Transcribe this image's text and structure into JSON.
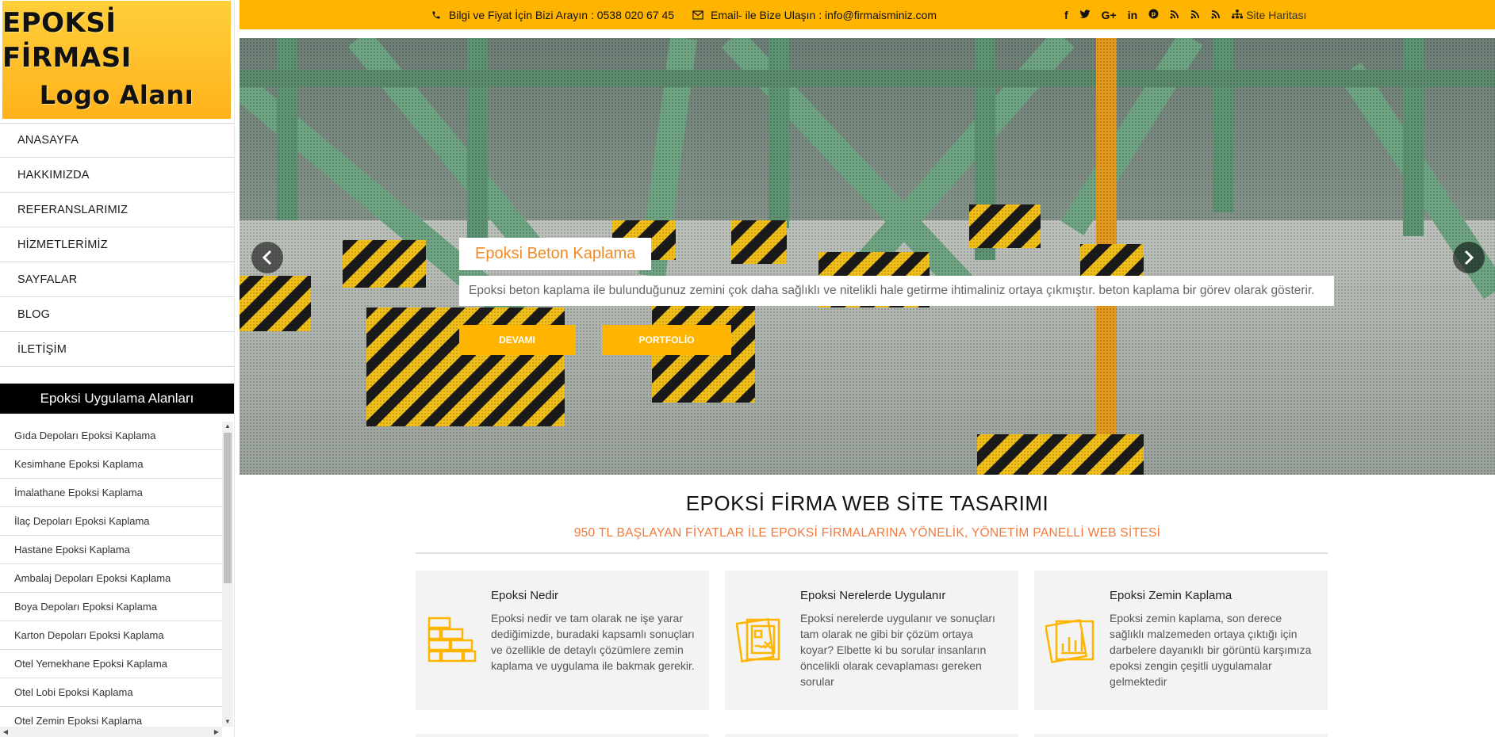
{
  "sidebar": {
    "logo_line1": "EPOKSİ FİRMASI",
    "logo_line2": "Logo Alanı",
    "nav": [
      {
        "label": "ANASAYFA"
      },
      {
        "label": "HAKKIMIZDA"
      },
      {
        "label": "REFERANSLARIMIZ"
      },
      {
        "label": "HİZMETLERİMİZ"
      },
      {
        "label": "SAYFALAR"
      },
      {
        "label": "BLOG"
      },
      {
        "label": "İLETİŞİM"
      }
    ],
    "apps_header": "Epoksi Uygulama Alanları",
    "apps": [
      {
        "label": "Gıda Depoları Epoksi Kaplama"
      },
      {
        "label": "Kesimhane Epoksi Kaplama"
      },
      {
        "label": "İmalathane Epoksi Kaplama"
      },
      {
        "label": "İlaç Depoları Epoksi Kaplama"
      },
      {
        "label": "Hastane Epoksi Kaplama"
      },
      {
        "label": "Ambalaj Depoları Epoksi Kaplama"
      },
      {
        "label": "Boya Depoları Epoksi Kaplama"
      },
      {
        "label": "Karton Depoları Epoksi Kaplama"
      },
      {
        "label": "Otel Yemekhane Epoksi Kaplama"
      },
      {
        "label": "Otel Lobi Epoksi Kaplama"
      },
      {
        "label": "Otel Zemin Epoksi Kaplama"
      }
    ]
  },
  "topbar": {
    "phone_text": "Bilgi ve Fiyat İçin Bizi Arayın : 0538 020 67 45",
    "email_text": "Email- ile Bize Ulaşın : info@firmaisminiz.com",
    "social_icons": [
      "facebook-icon",
      "twitter-icon",
      "google-plus-icon",
      "linkedin-icon",
      "pinterest-icon",
      "rss-icon",
      "rss-icon",
      "rss-icon"
    ],
    "sitemap_label": "Site Haritası",
    "accent": "#ffb400"
  },
  "hero": {
    "title": "Epoksi Beton Kaplama",
    "text": "Epoksi beton kaplama ile bulunduğunuz zemini çok daha sağlıklı ve nitelikli hale getirme ihtimaliniz ortaya çıkmıştır. beton kaplama bir görev olarak gösterir.",
    "btn_devami": "DEVAMI",
    "btn_portfolio": "PORTFOLİO"
  },
  "section": {
    "title": "EPOKSİ FİRMA WEB SİTE TASARIMI",
    "subtitle": "950 TL BAŞLAYAN FİYATLAR İLE EPOKSİ FİRMALARINA YÖNELİK, YÖNETİM PANELLİ WEB SİTESİ",
    "subtitle_color": "#f07a3a"
  },
  "cards": [
    {
      "title": "Epoksi Nedir",
      "text": "Epoksi nedir ve tam olarak ne işe yarar dediğimizde, buradaki kapsamlı sonuçları ve özellikle de detaylı çözümlere zemin kaplama ve uygulama ile bakmak gerekir.",
      "icon": "bricks-icon"
    },
    {
      "title": "Epoksi Nerelerde Uygulanır",
      "text": "Epoksi nerelerde uygulanır ve sonuçları tam olarak ne gibi bir çözüm ortaya koyar? Elbette ki bu sorular insanların öncelikli olarak cevaplaması gereken sorular",
      "icon": "blueprint-icon"
    },
    {
      "title": "Epoksi Zemin Kaplama",
      "text": "Epoksi zemin kaplama, son derece sağlıklı malzemeden ortaya çıktığı için darbelere dayanıklı bir görüntü karşımıza epoksi zengin çeşitli uygulamalar gelmektedir",
      "icon": "chart-document-icon"
    }
  ]
}
